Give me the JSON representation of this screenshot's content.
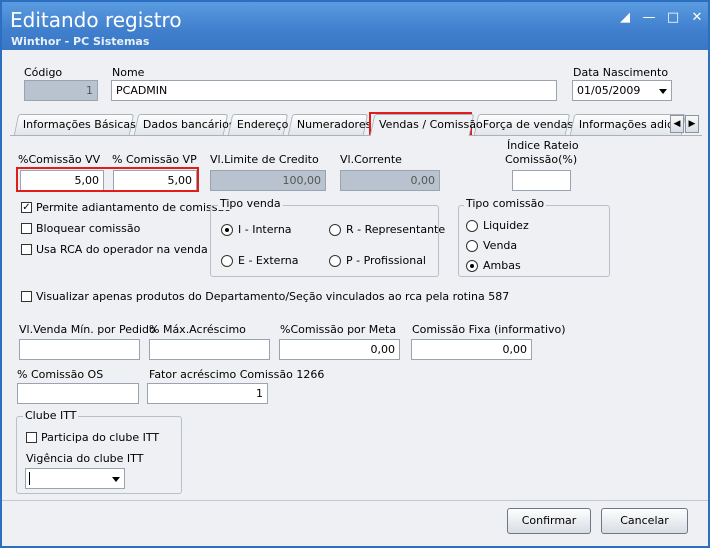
{
  "window": {
    "title": "Editando registro",
    "subtitle": "Winthor - PC Sistemas",
    "controls": [
      "restore-icon",
      "minimize-icon",
      "maximize-icon",
      "close-icon"
    ]
  },
  "header": {
    "codigo_label": "Código",
    "codigo_value": "1",
    "nome_label": "Nome",
    "nome_value": "PCADMIN",
    "nascimento_label": "Data Nascimento",
    "nascimento_value": "01/05/2009"
  },
  "tabs": [
    {
      "label": "Informações Básicas"
    },
    {
      "label": "Dados bancários"
    },
    {
      "label": "Endereço"
    },
    {
      "label": "Numeradores"
    },
    {
      "label": "Vendas  / Comissão",
      "active": true
    },
    {
      "label": "Força de vendas"
    },
    {
      "label": "Informações adicio"
    }
  ],
  "vendas": {
    "comissao_vv_label": "%Comissão VV",
    "comissao_vv_value": "5,00",
    "comissao_vp_label": "% Comissão VP",
    "comissao_vp_value": "5,00",
    "limite_label": "Vl.Limite de Credito",
    "limite_value": "100,00",
    "corrente_label": "Vl.Corrente",
    "corrente_value": "0,00",
    "rateio_label_1": "Índice Rateio",
    "rateio_label_2": "Comissão(%)",
    "rateio_value": ""
  },
  "checks": {
    "adiantamento": {
      "label": "Permite adiantamento de comissão",
      "checked": true
    },
    "bloquear": {
      "label": "Bloquear comissão",
      "checked": false
    },
    "usa_rca": {
      "label": "Usa RCA do operador na venda",
      "checked": false
    },
    "visualizar": {
      "label": "Visualizar apenas produtos do Departamento/Seção vinculados ao rca pela rotina 587",
      "checked": false
    }
  },
  "tipo_venda": {
    "title": "Tipo venda",
    "options": [
      {
        "label": "I - Interna",
        "selected": true
      },
      {
        "label": "R - Representante",
        "selected": false
      },
      {
        "label": "E - Externa",
        "selected": false
      },
      {
        "label": "P - Profissional",
        "selected": false
      }
    ]
  },
  "tipo_comissao": {
    "title": "Tipo comissão",
    "options": [
      {
        "label": "Liquidez",
        "selected": false
      },
      {
        "label": "Venda",
        "selected": false
      },
      {
        "label": "Ambas",
        "selected": true
      }
    ]
  },
  "row2": {
    "vl_min_label": "Vl.Venda Mín. por Pedido",
    "vl_min_value": "",
    "max_acresc_label": "% Máx.Acréscimo",
    "max_acresc_value": "",
    "comissao_meta_label": "%Comissão por Meta",
    "comissao_meta_value": "0,00",
    "comissao_fixa_label": "Comissão Fixa (informativo)",
    "comissao_fixa_value": "0,00"
  },
  "row3": {
    "comissao_os_label": "% Comissão OS",
    "comissao_os_value": "",
    "fator_label": "Fator acréscimo Comissão",
    "fator_code": "1266",
    "fator_value": "1"
  },
  "clube": {
    "title": "Clube ITT",
    "participa_label": "Participa do clube ITT",
    "participa_checked": false,
    "vigencia_label": "Vigência do clube ITT",
    "vigencia_value": ""
  },
  "buttons": {
    "confirmar": "Confirmar",
    "cancelar": "Cancelar"
  },
  "colors": {
    "title_bar": "#3f7fcd",
    "highlight": "#e21b1b",
    "readonly_field": "#b9c3cf"
  }
}
